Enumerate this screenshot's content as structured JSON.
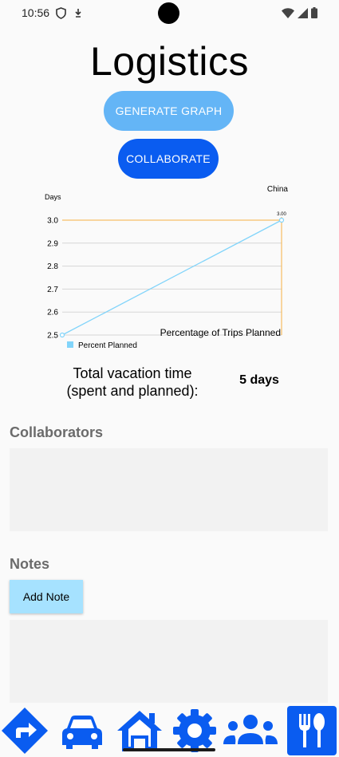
{
  "status_bar": {
    "time": "10:56",
    "icons": [
      "shield-icon",
      "download-icon",
      "wifi-icon",
      "signal-icon",
      "battery-icon"
    ]
  },
  "page": {
    "title": "Logistics"
  },
  "buttons": {
    "generate_graph": "GENERATE GRAPH",
    "collaborate": "COLLABORATE",
    "add_note": "Add Note"
  },
  "chart_data": {
    "type": "line",
    "title": "China",
    "ylabel": "Days",
    "description": "Percentage of Trips Planned",
    "x": [
      0,
      1
    ],
    "series": [
      {
        "name": "Percent Planned",
        "values": [
          2.5,
          3.0
        ],
        "color": "#81d4fa"
      }
    ],
    "ylim": [
      2.5,
      3.0
    ],
    "yticks": [
      "2.5",
      "2.6",
      "2.7",
      "2.8",
      "2.9",
      "3.0"
    ],
    "data_labels": [
      "3.00"
    ],
    "grid": true,
    "legend_position": "bottom-left",
    "highlight_color": "#f5b041"
  },
  "summary": {
    "vacation_label_line1": "Total vacation time",
    "vacation_label_line2": "(spent and planned):",
    "vacation_value": "5 days"
  },
  "sections": {
    "collaborators": "Collaborators",
    "notes": "Notes"
  },
  "nav": {
    "items": [
      "directions-icon",
      "car-icon",
      "home-icon",
      "settings-icon",
      "group-icon",
      "restaurant-icon"
    ],
    "active": "restaurant-icon",
    "icon_color": "#0a5cf0"
  }
}
